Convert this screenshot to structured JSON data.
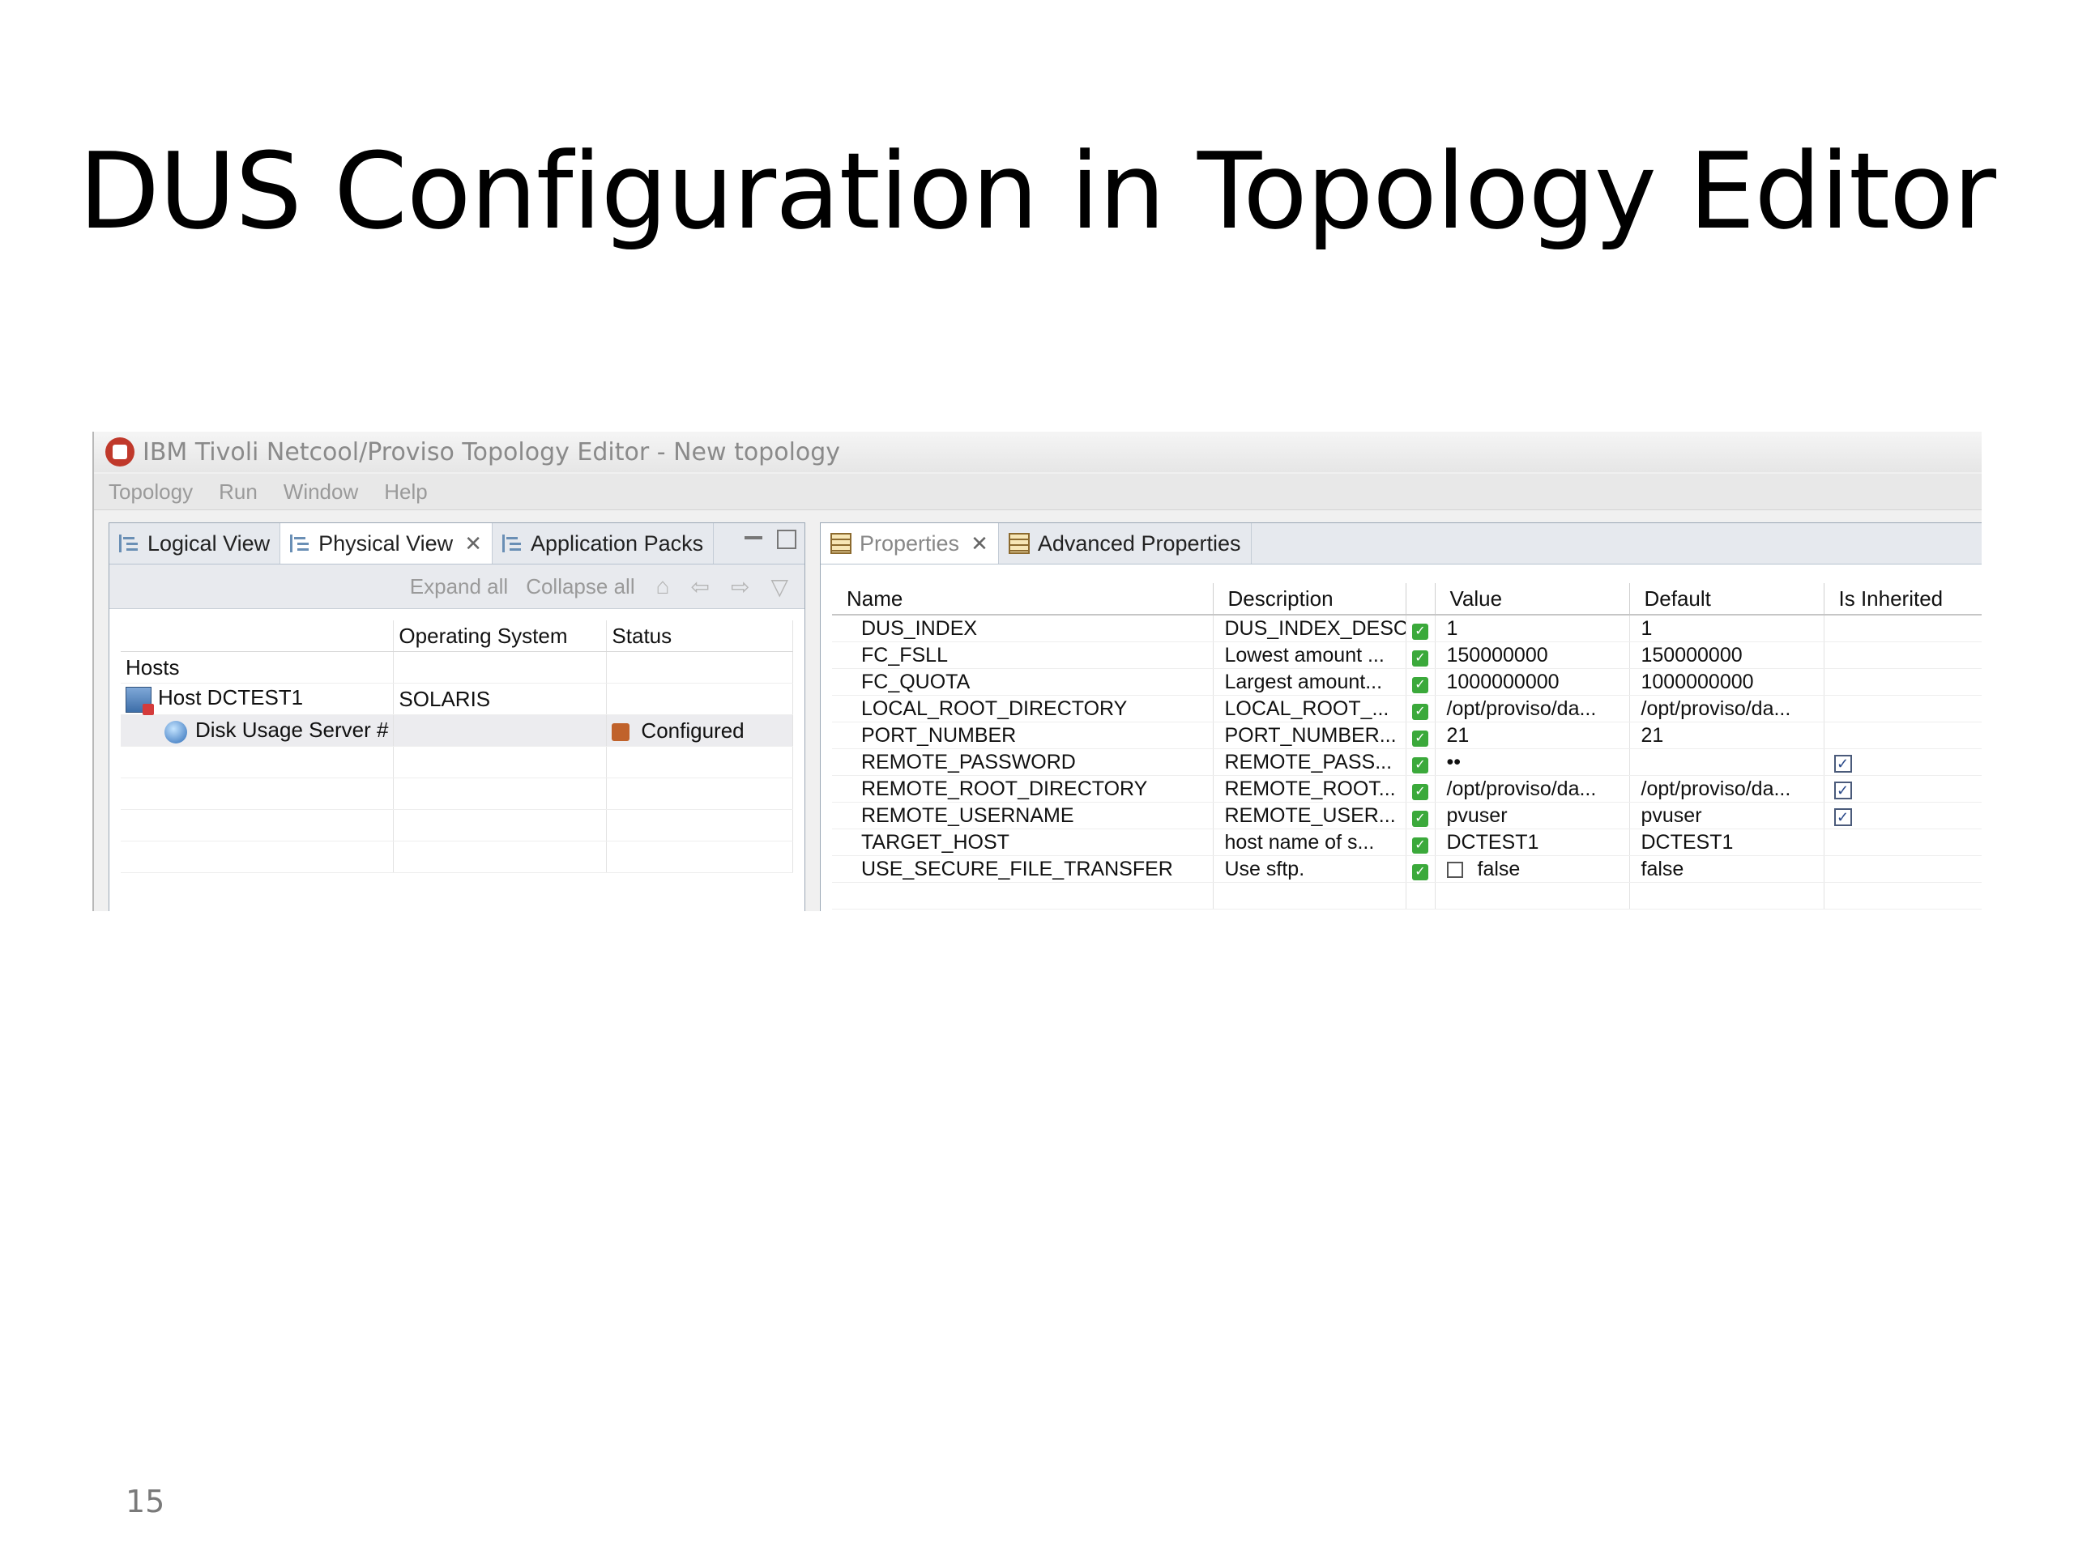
{
  "slide": {
    "title": "DUS Configuration in Topology Editor",
    "number": "15"
  },
  "window": {
    "title": "IBM Tivoli Netcool/Proviso Topology Editor - New topology",
    "menu": [
      "Topology",
      "Run",
      "Window",
      "Help"
    ]
  },
  "left_pane": {
    "tabs": [
      {
        "label": "Logical View",
        "icon": "tree-icon"
      },
      {
        "label": "Physical View",
        "icon": "tree-icon",
        "active": true
      },
      {
        "label": "Application Packs",
        "icon": "tree-icon"
      }
    ],
    "toolbar": {
      "expand_all": "Expand all",
      "collapse_all": "Collapse all"
    },
    "columns": [
      "",
      "Operating System",
      "Status"
    ],
    "rows": [
      {
        "name": "Hosts",
        "os": "",
        "status": ""
      },
      {
        "name": "Host DCTEST1",
        "os": "SOLARIS",
        "status": ""
      },
      {
        "name": "Disk Usage Server #",
        "os": "",
        "status": "Configured"
      }
    ]
  },
  "right_pane": {
    "tabs": [
      {
        "label": "Properties",
        "icon": "table-icon",
        "active": true
      },
      {
        "label": "Advanced Properties",
        "icon": "table-icon"
      }
    ],
    "columns": [
      "Name",
      "Description",
      "",
      "Value",
      "Default",
      "Is Inherited"
    ],
    "rows": [
      {
        "name": "DUS_INDEX",
        "description": "DUS_INDEX_DESC",
        "value": "1",
        "default": "1",
        "inherited": false
      },
      {
        "name": "FC_FSLL",
        "description": "Lowest amount ...",
        "value": "150000000",
        "default": "150000000",
        "inherited": false
      },
      {
        "name": "FC_QUOTA",
        "description": "Largest amount...",
        "value": "1000000000",
        "default": "1000000000",
        "inherited": false
      },
      {
        "name": "LOCAL_ROOT_DIRECTORY",
        "description": "LOCAL_ROOT_...",
        "value": "/opt/proviso/da...",
        "default": "/opt/proviso/da...",
        "inherited": false
      },
      {
        "name": "PORT_NUMBER",
        "description": "PORT_NUMBER...",
        "value": "21",
        "default": "21",
        "inherited": false
      },
      {
        "name": "REMOTE_PASSWORD",
        "description": "REMOTE_PASS...",
        "value": "••",
        "default": "",
        "inherited": true
      },
      {
        "name": "REMOTE_ROOT_DIRECTORY",
        "description": "REMOTE_ROOT...",
        "value": "/opt/proviso/da...",
        "default": "/opt/proviso/da...",
        "inherited": true
      },
      {
        "name": "REMOTE_USERNAME",
        "description": "REMOTE_USER...",
        "value": "pvuser",
        "default": "pvuser",
        "inherited": true
      },
      {
        "name": "TARGET_HOST",
        "description": "host name of s...",
        "value": "DCTEST1",
        "default": "DCTEST1",
        "inherited": false
      },
      {
        "name": "USE_SECURE_FILE_TRANSFER",
        "description": "Use sftp.",
        "value": "false",
        "default": "false",
        "inherited": false,
        "value_checkbox": true
      }
    ]
  }
}
